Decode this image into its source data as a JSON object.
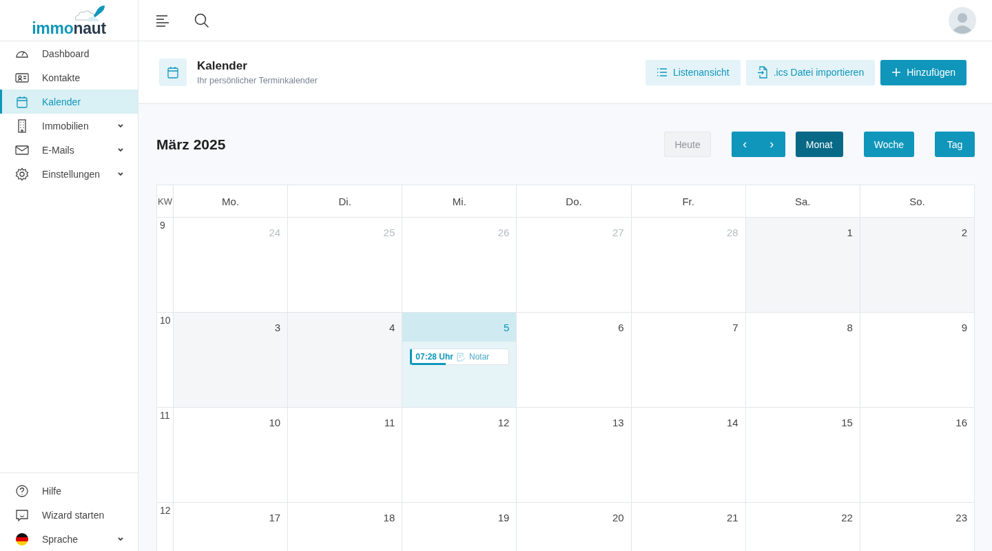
{
  "logo": {
    "part_1": "immo",
    "part_2": "naut"
  },
  "sidebar": {
    "items": [
      {
        "label": "Dashboard",
        "selected": false,
        "expandable": false
      },
      {
        "label": "Kontakte",
        "selected": false,
        "expandable": false
      },
      {
        "label": "Kalender",
        "selected": true,
        "expandable": false
      },
      {
        "label": "Immobilien",
        "selected": false,
        "expandable": true
      },
      {
        "label": "E-Mails",
        "selected": false,
        "expandable": true
      },
      {
        "label": "Einstellungen",
        "selected": false,
        "expandable": true
      }
    ],
    "footer_items": [
      {
        "label": "Hilfe",
        "expandable": false
      },
      {
        "label": "Wizard starten",
        "expandable": false
      },
      {
        "label": "Sprache",
        "expandable": true
      }
    ]
  },
  "page_header": {
    "title": "Kalender",
    "subtitle": "Ihr persönlicher Terminkalender",
    "buttons": [
      {
        "label": "Listenansicht",
        "kind": "list"
      },
      {
        "label": ".ics Datei importieren",
        "kind": "import"
      },
      {
        "label": "Hinzufügen",
        "kind": "add"
      }
    ]
  },
  "calendar": {
    "title": "März 2025",
    "today_button": {
      "label": "Heute",
      "disabled": true
    },
    "prev": "‹",
    "next": "›",
    "views": [
      {
        "label": "Monat",
        "selected": true
      },
      {
        "label": "Woche",
        "selected": false
      },
      {
        "label": "Tag",
        "selected": false
      }
    ],
    "week_header": "KW",
    "weekdays": [
      "Mo.",
      "Di.",
      "Mi.",
      "Do.",
      "Fr.",
      "Sa.",
      "So."
    ],
    "weeks": [
      {
        "kw": "9",
        "days": [
          {
            "label": "24",
            "kind": "outside"
          },
          {
            "label": "25",
            "kind": "outside"
          },
          {
            "label": "26",
            "kind": "outside"
          },
          {
            "label": "27",
            "kind": "outside"
          },
          {
            "label": "28",
            "kind": "outside"
          },
          {
            "label": "1",
            "kind": "past"
          },
          {
            "label": "2",
            "kind": "past"
          }
        ]
      },
      {
        "kw": "10",
        "days": [
          {
            "label": "3",
            "kind": "past"
          },
          {
            "label": "4",
            "kind": "past"
          },
          {
            "label": "5",
            "kind": "today",
            "events": [
              {
                "time": "07:28 Uhr",
                "title": "Notar",
                "level": 0.35
              }
            ]
          },
          {
            "label": "6",
            "kind": "normal"
          },
          {
            "label": "7",
            "kind": "normal"
          },
          {
            "label": "8",
            "kind": "normal"
          },
          {
            "label": "9",
            "kind": "normal"
          }
        ]
      },
      {
        "kw": "11",
        "days": [
          {
            "label": "10",
            "kind": "normal"
          },
          {
            "label": "11",
            "kind": "normal"
          },
          {
            "label": "12",
            "kind": "normal"
          },
          {
            "label": "13",
            "kind": "normal"
          },
          {
            "label": "14",
            "kind": "normal"
          },
          {
            "label": "15",
            "kind": "normal"
          },
          {
            "label": "16",
            "kind": "normal"
          }
        ]
      },
      {
        "kw": "12",
        "days": [
          {
            "label": "17",
            "kind": "normal"
          },
          {
            "label": "18",
            "kind": "normal"
          },
          {
            "label": "19",
            "kind": "normal"
          },
          {
            "label": "20",
            "kind": "normal"
          },
          {
            "label": "21",
            "kind": "normal"
          },
          {
            "label": "22",
            "kind": "normal"
          },
          {
            "label": "23",
            "kind": "normal"
          }
        ]
      }
    ]
  }
}
